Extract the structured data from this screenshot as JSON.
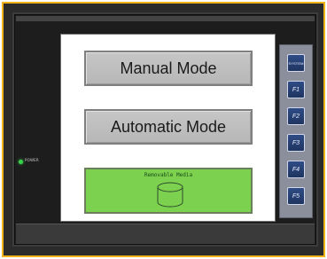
{
  "screen": {
    "buttons": {
      "manual_mode": "Manual Mode",
      "automatic_mode": "Automatic Mode"
    },
    "media_panel": {
      "label": "Removable Media",
      "icon": "removable-media-icon",
      "color": "#7cd24e"
    }
  },
  "side_panel": {
    "keys": [
      {
        "label": "SYSTEM"
      },
      {
        "label": "F1"
      },
      {
        "label": "F2"
      },
      {
        "label": "F3"
      },
      {
        "label": "F4"
      },
      {
        "label": "F5"
      }
    ]
  },
  "indicators": {
    "power_label": "POWER",
    "power_color": "#39d24b"
  },
  "colors": {
    "frame_accent": "#f0b41a",
    "key_blue": "#2e4c86"
  }
}
